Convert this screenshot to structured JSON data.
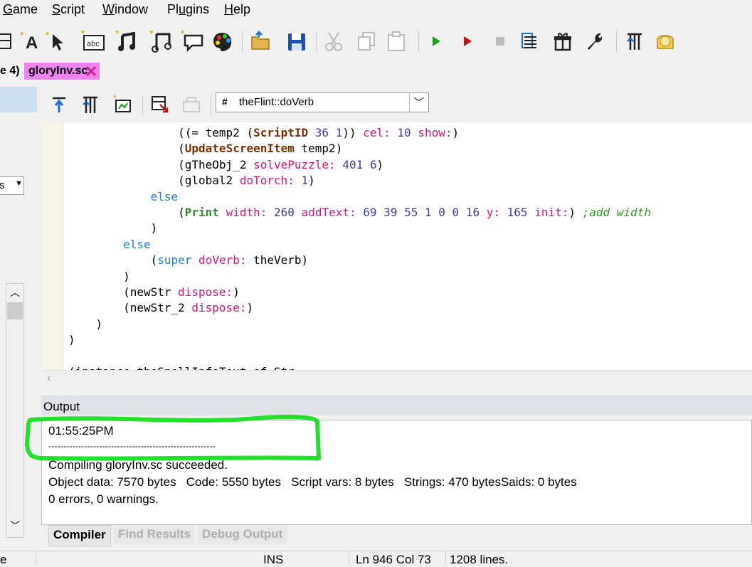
{
  "menu": {
    "items": [
      "Game",
      "Script",
      "Window",
      "Plugins",
      "Help"
    ],
    "underline": [
      "G",
      "S",
      "W",
      "u",
      "H"
    ]
  },
  "tabs": {
    "prev_label": "e 4)",
    "active_label": "gloryInv.sc"
  },
  "left_panel": {
    "dropdown_label": "s"
  },
  "editor_toolbar": {
    "method_combo_value": "theFlint::doVerb"
  },
  "code": {
    "lines": [
      "                ((= temp2 (ScriptID 36 1)) cel: 10 show:)",
      "                (UpdateScreenItem temp2)",
      "                (gTheObj_2 solvePuzzle: 401 6)",
      "                (global2 doTorch: 1)",
      "            else",
      "                (Print width: 260 addText: 69 39 55 1 0 0 16 y: 165 init:) ;add width",
      "            )",
      "        else",
      "            (super doVerb: theVerb)",
      "        )",
      "        (newStr dispose:)",
      "        (newStr_2 dispose:)",
      "    )",
      ")"
    ],
    "partial_last_line": "(instance theSpellInfoText of Str"
  },
  "output": {
    "header": "Output",
    "lines": [
      "01:55:25PM",
      "--------------------------------------------------------",
      "Compiling gloryInv.sc succeeded.",
      "Object data: 7570 bytes   Code: 5550 bytes   Script vars: 8 bytes   Strings: 470 bytesSaids: 0 bytes",
      "0 errors, 0 warnings."
    ],
    "tabs": [
      "Compiler",
      "Find Results",
      "Debug Output"
    ]
  },
  "status": {
    "left": "e",
    "mode": "INS",
    "position": "Ln 946 Col 73",
    "lines": "1208 lines."
  },
  "colors": {
    "highlight_green": "#22e02c",
    "tab_active_bg": "#ee82ee",
    "keyword_selector": "#e0117a",
    "number": "#3c3ca8",
    "keyword_control": "#1e7bd6",
    "comment": "#2f9a1f"
  }
}
